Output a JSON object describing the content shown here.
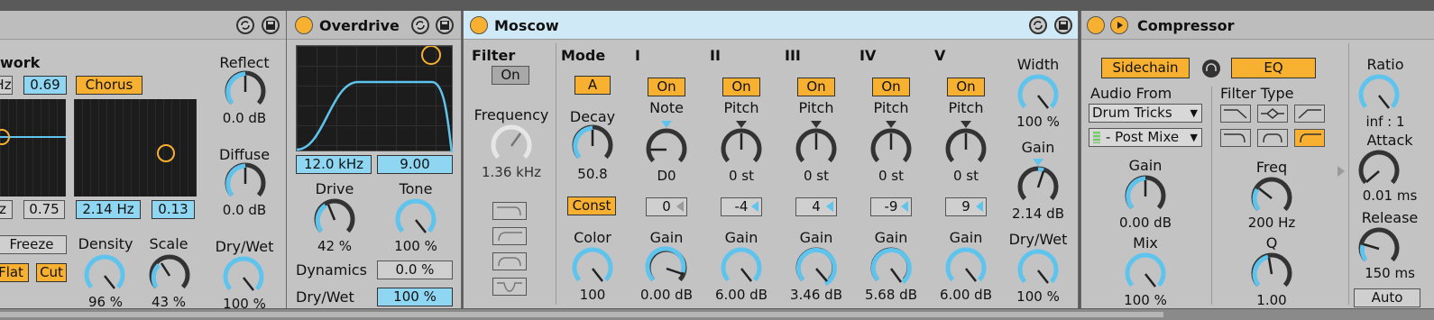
{
  "reverb": {
    "work_label": "work",
    "reflect_label": "Reflect",
    "reflect_value": "0.0 dB",
    "diffuse_label": "Diffuse",
    "diffuse_value": "0.0 dB",
    "hz_partial": "Hz",
    "val_069": "0.69",
    "chorus_label": "Chorus",
    "z_partial": "z",
    "val_075": "0.75",
    "hz_214": "2.14 Hz",
    "val_013": "0.13",
    "freeze_label": "Freeze",
    "flat_label": "Flat",
    "cut_label": "Cut",
    "density_label": "Density",
    "density_value": "96 %",
    "scale_label": "Scale",
    "scale_value": "43 %",
    "drywet_label": "Dry/Wet",
    "drywet_value": "100 %"
  },
  "overdrive": {
    "title": "Overdrive",
    "freq_value": "12.0 kHz",
    "width_value": "9.00",
    "drive_label": "Drive",
    "drive_value": "42 %",
    "tone_label": "Tone",
    "tone_value": "100 %",
    "dynamics_label": "Dynamics",
    "dynamics_value": "0.0 %",
    "drywet_label": "Dry/Wet",
    "drywet_value": "100 %"
  },
  "moscow": {
    "title": "Moscow",
    "filter_label": "Filter",
    "filter_on": "On",
    "frequency_label": "Frequency",
    "frequency_value": "1.36 kHz",
    "mode_label": "Mode",
    "mode_value": "A",
    "decay_label": "Decay",
    "decay_value": "50.8",
    "const_label": "Const",
    "color_label": "Color",
    "color_value": "100",
    "voices": [
      {
        "name": "I",
        "on": "On",
        "param": "Note",
        "value": "D0",
        "box": "0",
        "gain_label": "Gain",
        "gain": "0.00 dB"
      },
      {
        "name": "II",
        "on": "On",
        "param": "Pitch",
        "value": "0 st",
        "box": "-4",
        "gain_label": "Gain",
        "gain": "6.00 dB"
      },
      {
        "name": "III",
        "on": "On",
        "param": "Pitch",
        "value": "0 st",
        "box": "4",
        "gain_label": "Gain",
        "gain": "3.46 dB"
      },
      {
        "name": "IV",
        "on": "On",
        "param": "Pitch",
        "value": "0 st",
        "box": "-9",
        "gain_label": "Gain",
        "gain": "5.68 dB"
      },
      {
        "name": "V",
        "on": "On",
        "param": "Pitch",
        "value": "0 st",
        "box": "9",
        "gain_label": "Gain",
        "gain": "6.00 dB"
      }
    ],
    "width_label": "Width",
    "width_value": "100 %",
    "gain_label": "Gain",
    "gain_value": "2.14 dB",
    "drywet_label": "Dry/Wet",
    "drywet_value": "100 %"
  },
  "compressor": {
    "title": "Compressor",
    "sidechain_label": "Sidechain",
    "eq_label": "EQ",
    "audio_from_label": "Audio From",
    "audio_from_value": "Drum Tricks",
    "post_mixer_value": "- Post Mixe",
    "filter_type_label": "Filter Type",
    "gain_label": "Gain",
    "gain_value": "0.00 dB",
    "mix_label": "Mix",
    "mix_value": "100 %",
    "freq_label": "Freq",
    "freq_value": "200 Hz",
    "q_label": "Q",
    "q_value": "1.00",
    "ratio_label": "Ratio",
    "ratio_value": "inf : 1",
    "attack_label": "Attack",
    "attack_value": "0.01 ms",
    "release_label": "Release",
    "release_value": "150 ms",
    "auto_label": "Auto"
  },
  "colors": {
    "accent_orange": "#f8b030",
    "accent_blue": "#5ec4ee",
    "panel_bg": "#c3c3c3",
    "selected_header": "#cfe9f6"
  }
}
